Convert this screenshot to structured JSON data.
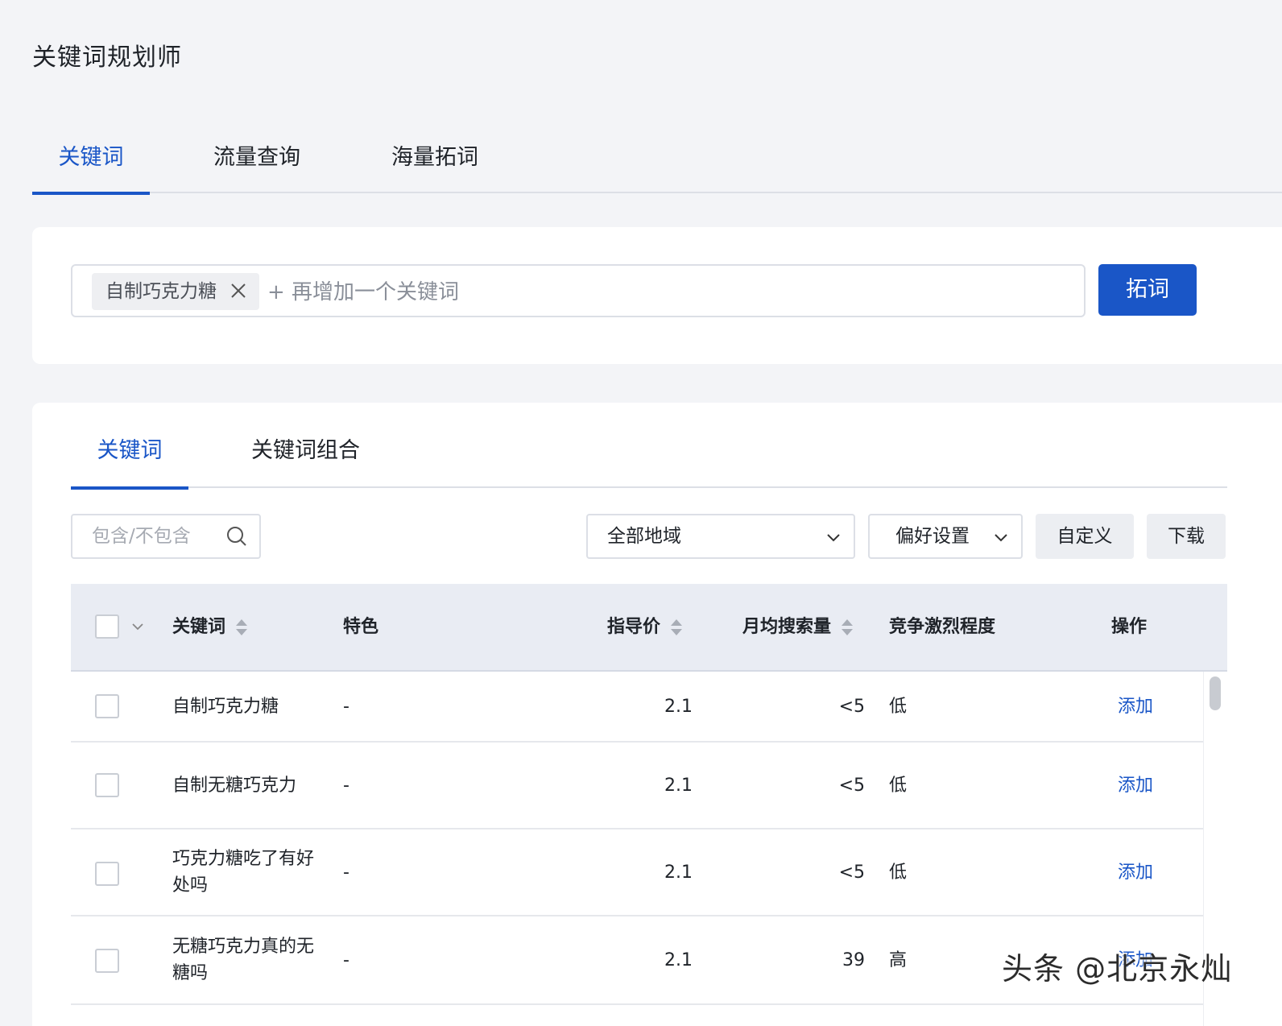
{
  "page": {
    "title": "关键词规划师"
  },
  "top_tabs": [
    {
      "label": "关键词",
      "active": true
    },
    {
      "label": "流量查询",
      "active": false
    },
    {
      "label": "海量拓词",
      "active": false
    }
  ],
  "search": {
    "tag": "自制巧克力糖",
    "add_placeholder": "+ 再增加一个关键词",
    "submit_label": "拓词"
  },
  "sub_tabs": [
    {
      "label": "关键词",
      "active": true
    },
    {
      "label": "关键词组合",
      "active": false
    }
  ],
  "filters": {
    "include_placeholder": "包含/不包含",
    "region": "全部地域",
    "preference": "偏好设置",
    "customize": "自定义",
    "download": "下载"
  },
  "table": {
    "headers": {
      "keyword": "关键词",
      "feature": "特色",
      "price": "指导价",
      "monthly_search": "月均搜索量",
      "competition": "竞争激烈程度",
      "action": "操作"
    },
    "rows": [
      {
        "keyword": "自制巧克力糖",
        "feature": "-",
        "price": "2.1",
        "monthly_search": "<5",
        "competition": "低",
        "action": "添加"
      },
      {
        "keyword": "自制无糖巧克力",
        "feature": "-",
        "price": "2.1",
        "monthly_search": "<5",
        "competition": "低",
        "action": "添加"
      },
      {
        "keyword": "巧克力糖吃了有好处吗",
        "feature": "-",
        "price": "2.1",
        "monthly_search": "<5",
        "competition": "低",
        "action": "添加"
      },
      {
        "keyword": "无糖巧克力真的无糖吗",
        "feature": "-",
        "price": "2.1",
        "monthly_search": "39",
        "competition": "高",
        "action": "添加"
      }
    ]
  },
  "watermark": "头条 @北京永灿",
  "colors": {
    "accent": "#1a56c7",
    "background": "#f3f4f7",
    "header": "#e9ecf3"
  }
}
